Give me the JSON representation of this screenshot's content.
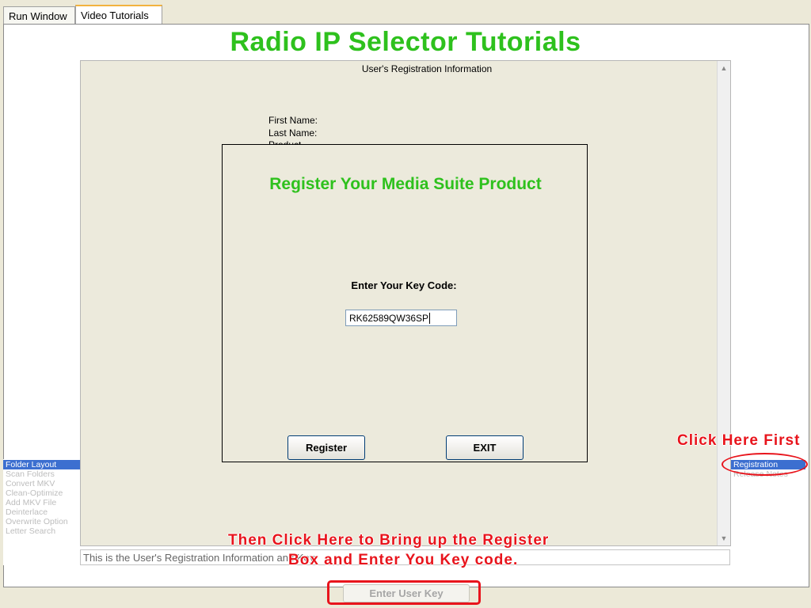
{
  "tabs": [
    {
      "label": "Run Window",
      "active": false
    },
    {
      "label": "Video Tutorials",
      "active": true
    }
  ],
  "page_title": "Radio IP Selector Tutorials",
  "registration": {
    "header": "User's Registration Information",
    "fields": {
      "first_name": "First Name:",
      "last_name": "Last  Name:",
      "product": "Product"
    }
  },
  "dialog": {
    "title": "Register Your Media Suite Product",
    "key_label": "Enter Your Key Code:",
    "key_value": "RK62589QW36SP",
    "register_label": "Register",
    "exit_label": "EXIT"
  },
  "left_list": {
    "items": [
      {
        "label": "Folder Layout",
        "selected": true
      },
      {
        "label": "Scan Folders",
        "selected": false
      },
      {
        "label": "Convert MKV",
        "selected": false
      },
      {
        "label": "Clean-Optimize",
        "selected": false
      },
      {
        "label": "Add MKV File",
        "selected": false
      },
      {
        "label": "Deinterlace",
        "selected": false
      },
      {
        "label": "Overwrite Option",
        "selected": false
      },
      {
        "label": "Letter Search",
        "selected": false
      }
    ]
  },
  "right_list": {
    "items": [
      {
        "label": "Registration",
        "selected": true
      },
      {
        "label": "Release Notes",
        "selected": false
      }
    ]
  },
  "annotations": {
    "click_first": "Click Here First",
    "then_click_line1": "Then Click Here to Bring up the Register",
    "then_click_line2": "Box and Enter You Key code."
  },
  "status_text": "This is the User's Registration Information and Key",
  "enter_key_button": "Enter User Key",
  "colors": {
    "title_green": "#2ec11d",
    "annotation_red": "#e8141c",
    "selection_blue": "#3c6fd0"
  }
}
